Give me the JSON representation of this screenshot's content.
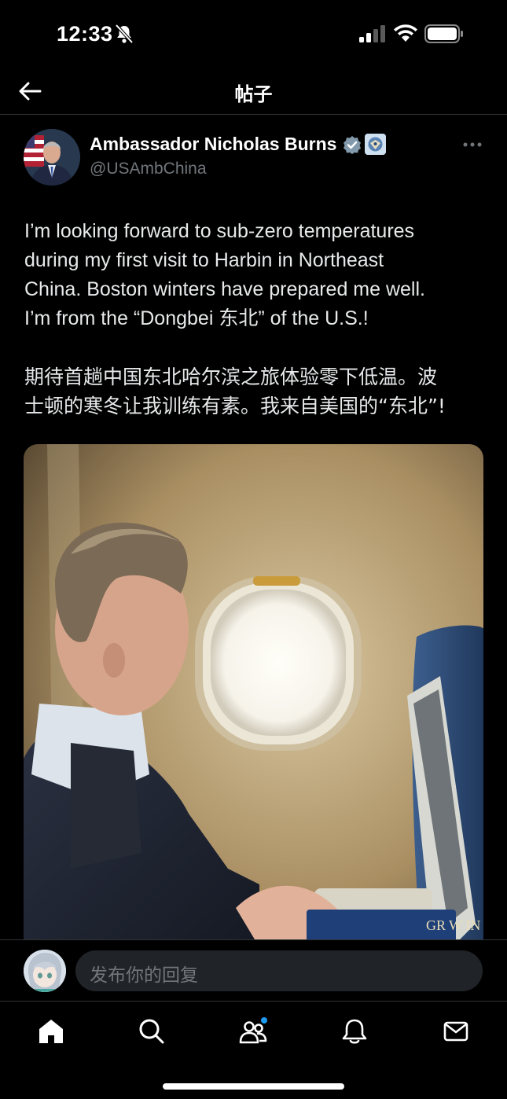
{
  "status": {
    "time": "12:33"
  },
  "header": {
    "title": "帖子"
  },
  "post": {
    "author_name": "Ambassador Nicholas Burns",
    "handle": "@USAmbChina",
    "text_en": "I’m looking forward to sub-zero temperatures\nduring my first visit to Harbin in Northeast\nChina. Boston winters have prepared me well.\nI’m from the “Dongbei 东北” of the U.S.!",
    "text_zh": "期待首趟中国东北哈尔滨之旅体验零下低温。波\n士顿的寒冬让我训练有素。我来自美国的“东北”!",
    "image_book_text": "GR W IN"
  },
  "reply": {
    "placeholder": "发布你的回复"
  },
  "tabs": [
    {
      "name": "home",
      "icon": "home-icon"
    },
    {
      "name": "search",
      "icon": "search-icon"
    },
    {
      "name": "communities",
      "icon": "communities-icon"
    },
    {
      "name": "notifications",
      "icon": "bell-icon"
    },
    {
      "name": "messages",
      "icon": "mail-icon"
    }
  ],
  "colors": {
    "background": "#000000",
    "accent": "#1d9bf0",
    "muted": "#71767b",
    "text": "#e7e9ea"
  }
}
